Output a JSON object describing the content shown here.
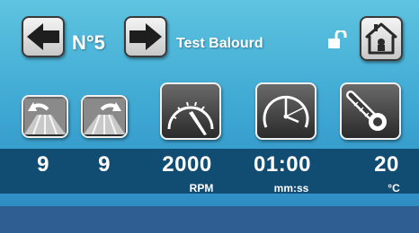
{
  "header": {
    "program_number": "N°5",
    "title": "Test Balourd"
  },
  "readouts": [
    {
      "name": "left-tilt",
      "value": "9",
      "unit": ""
    },
    {
      "name": "right-tilt",
      "value": "9",
      "unit": ""
    },
    {
      "name": "speed",
      "value": "2000",
      "unit": "RPM"
    },
    {
      "name": "duration",
      "value": "01:00",
      "unit": "mm:ss"
    },
    {
      "name": "temperature",
      "value": "20",
      "unit": "°C"
    }
  ],
  "icons": {
    "prev": "arrow-left-icon",
    "next": "arrow-right-icon",
    "lock": "unlocked-padlock-icon",
    "home": "home-icon",
    "tilt_left": "road-tilt-left-icon",
    "tilt_right": "road-tilt-right-icon",
    "speed": "speedometer-icon",
    "time": "clock-icon",
    "temp": "thermometer-icon"
  }
}
